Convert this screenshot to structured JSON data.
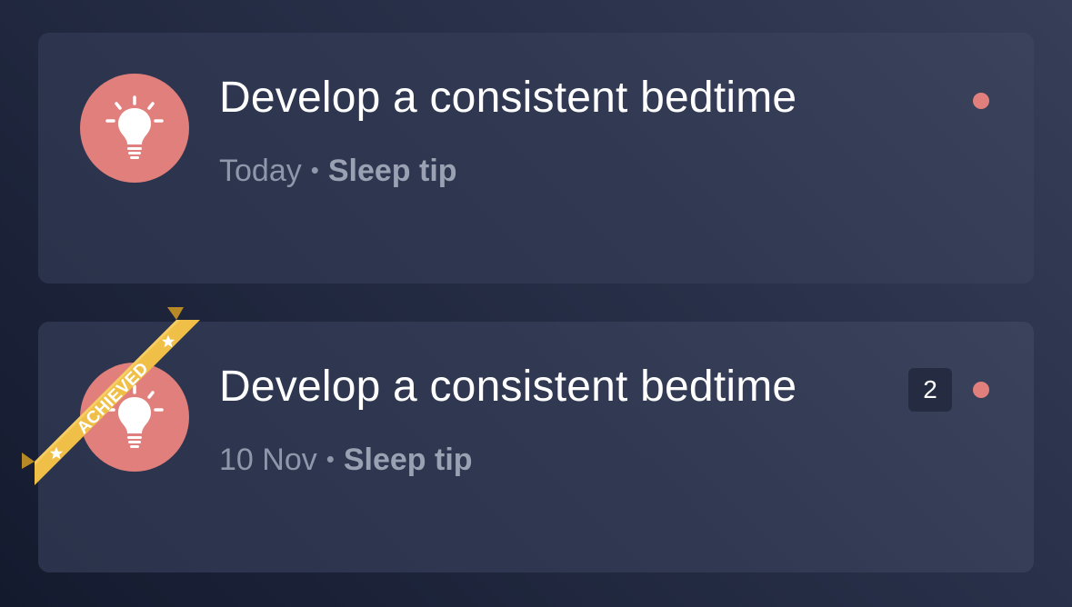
{
  "items": [
    {
      "title": "Develop a consistent bedtime",
      "date": "Today",
      "separator": "•",
      "category": "Sleep tip",
      "icon": "lightbulb-icon",
      "unread": true
    },
    {
      "title": "Develop a consistent bedtime",
      "date": "10 Nov",
      "separator": "•",
      "category": "Sleep tip",
      "icon": "lightbulb-icon",
      "unread": true,
      "count": "2",
      "ribbon": "ACHIEVED"
    }
  ],
  "colors": {
    "accent": "#e07f7b",
    "ribbon": "#f0bf48",
    "background": "#1c2339",
    "card": "#303852"
  }
}
